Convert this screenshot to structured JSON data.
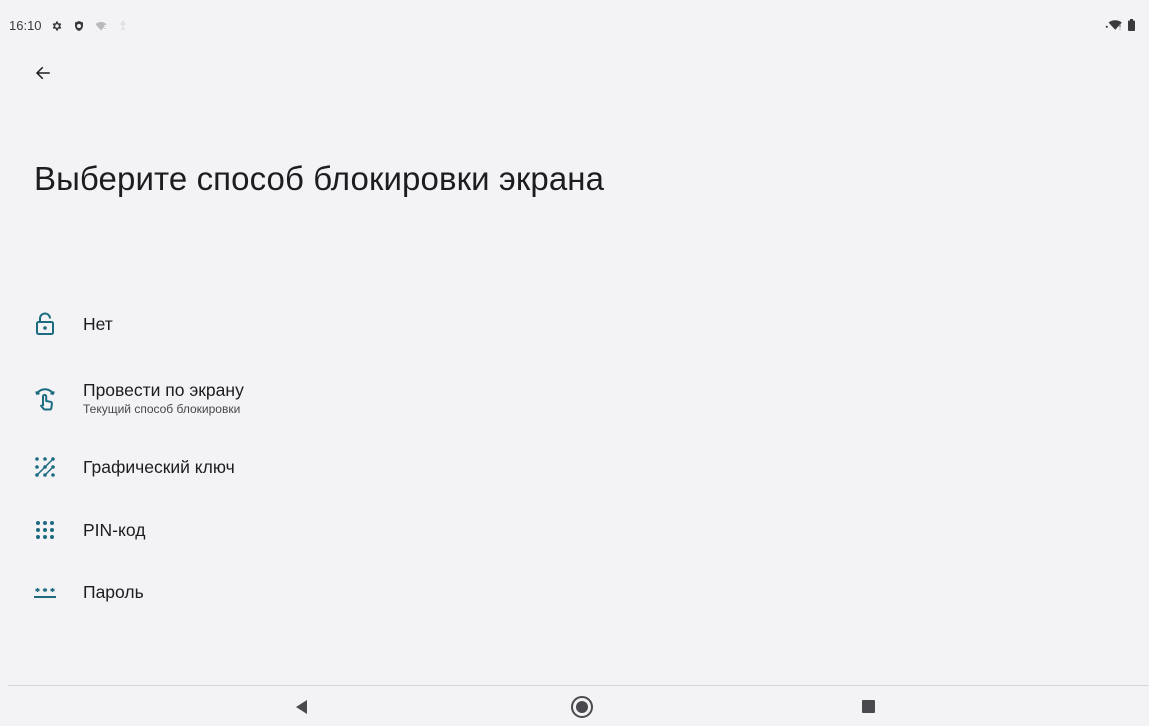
{
  "status_bar": {
    "time": "16:10",
    "icons_left": [
      "gear-icon",
      "shield-icon",
      "wifi-question-icon",
      "accessibility-icon"
    ],
    "icons_right": [
      "wifi-icon",
      "battery-icon"
    ]
  },
  "toolbar": {
    "back_icon": "arrow-left-icon"
  },
  "page": {
    "title": "Выберите способ блокировки экрана"
  },
  "options": [
    {
      "icon": "lock-open-icon",
      "label": "Нет",
      "sub": ""
    },
    {
      "icon": "swipe-icon",
      "label": "Провести по экрану",
      "sub": "Текущий способ блокировки"
    },
    {
      "icon": "pattern-icon",
      "label": "Графический ключ",
      "sub": ""
    },
    {
      "icon": "pin-icon",
      "label": "PIN-код",
      "sub": ""
    },
    {
      "icon": "password-icon",
      "label": "Пароль",
      "sub": ""
    }
  ],
  "nav_bar": {
    "buttons": [
      "back-triangle-icon",
      "home-circle-icon",
      "recents-square-icon"
    ]
  },
  "colors": {
    "accent": "#1c6b80",
    "background": "#f3f3f5",
    "text": "#1d1d21"
  }
}
